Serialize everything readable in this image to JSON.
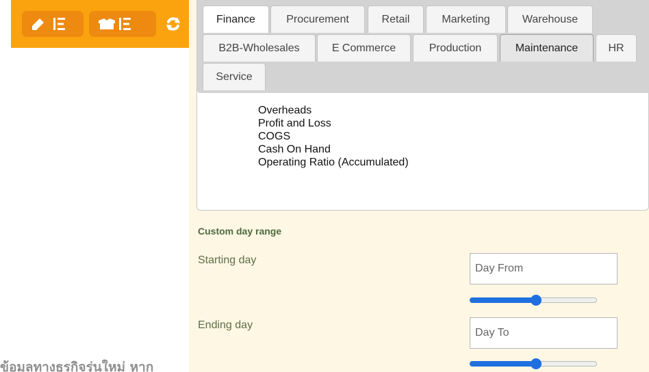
{
  "toolbar": {
    "buttons": [
      {
        "icon": "pencil-list-icon"
      },
      {
        "icon": "box-list-icon"
      }
    ],
    "refresh_icon": "refresh-icon",
    "colors": {
      "bar": "#fba30f",
      "button": "#ee8a10"
    }
  },
  "tabs": {
    "rows": [
      [
        "Finance",
        "Procurement",
        "Retail",
        "Marketing",
        "Warehouse"
      ],
      [
        "B2B-Wholesales",
        "E Commerce",
        "Production",
        "Maintenance",
        "HR"
      ],
      [
        "Service"
      ]
    ],
    "active": "Finance",
    "highlighted": "Maintenance"
  },
  "reports": [
    "Overheads",
    "Profit and Loss",
    "COGS",
    "Cash On Hand",
    "Operating Ratio  (Accumulated)"
  ],
  "day_range": {
    "title": "Custom day range",
    "start": {
      "label": "Starting day",
      "placeholder": "Day From",
      "value": "",
      "slider_fraction": 0.52
    },
    "end": {
      "label": "Ending day",
      "placeholder": "Day To",
      "value": "",
      "slider_fraction": 0.52
    }
  },
  "footer_text": "ข้อมูลทางธุรกิจรุ่นใหม่ หาก",
  "colors": {
    "accent": "#1f6fe0",
    "cream": "#fdf7e4"
  }
}
